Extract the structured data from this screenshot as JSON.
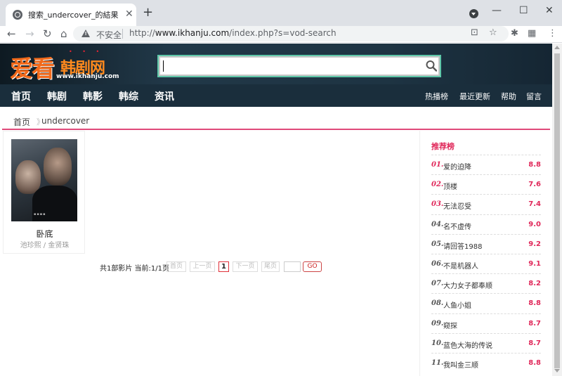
{
  "browser": {
    "tab_title": "搜索_undercover_的結果",
    "tab_close": "✕",
    "new_tab": "+",
    "minimize": "—",
    "maximize": "☐",
    "close": "✕",
    "insecure_label": "不安全",
    "url_prefix": "http://",
    "url_host": "www.ikhanju.com",
    "url_path": "/index.php?s=vod-search",
    "icons": [
      "back-icon",
      "forward-icon",
      "reload-icon",
      "home-icon",
      "warning-icon",
      "translate-icon",
      "star-icon",
      "extensions-icon",
      "profile-icon",
      "menu-icon"
    ]
  },
  "site": {
    "logo_main": "爱看",
    "logo_sub": "韩剧网",
    "logo_url": "www.ikhanju.com",
    "search_value": "",
    "nav_left": [
      "首页",
      "韩剧",
      "韩影",
      "韩综",
      "资讯"
    ],
    "nav_right": [
      "热播榜",
      "最近更新",
      "帮助",
      "留言"
    ]
  },
  "breadcrumb": {
    "home": "首页",
    "separator": "》",
    "current": "undercover"
  },
  "result": {
    "title": "卧底",
    "actors": "池珍熙 / 金贤珠"
  },
  "pagination": {
    "summary": "共1部影片 当前:1/1页",
    "first": "首页",
    "prev": "上一页",
    "current": "1",
    "next": "下一页",
    "last": "尾页",
    "go": "GO"
  },
  "ranking": {
    "heading": "推荐榜",
    "accent": "#e0285a",
    "items": [
      {
        "no": "01.",
        "title": "爱的迫降",
        "score": "8.8",
        "color": "#e0285a"
      },
      {
        "no": "02.",
        "title": "顶楼",
        "score": "7.6",
        "color": "#e0285a"
      },
      {
        "no": "03.",
        "title": "无法忍受",
        "score": "7.4",
        "color": "#e0285a"
      },
      {
        "no": "04.",
        "title": "名不虚传",
        "score": "9.0",
        "color": "#555555"
      },
      {
        "no": "05.",
        "title": "请回答1988",
        "score": "9.2",
        "color": "#555555"
      },
      {
        "no": "06.",
        "title": "不是机器人",
        "score": "9.1",
        "color": "#555555"
      },
      {
        "no": "07.",
        "title": "大力女子都奉顺",
        "score": "8.2",
        "color": "#555555"
      },
      {
        "no": "08.",
        "title": "人鱼小姐",
        "score": "8.8",
        "color": "#555555"
      },
      {
        "no": "09.",
        "title": "窥探",
        "score": "8.7",
        "color": "#555555"
      },
      {
        "no": "10.",
        "title": "蓝色大海的传说",
        "score": "8.7",
        "color": "#555555"
      },
      {
        "no": "11.",
        "title": "我叫金三顺",
        "score": "8.8",
        "color": "#555555"
      }
    ]
  }
}
